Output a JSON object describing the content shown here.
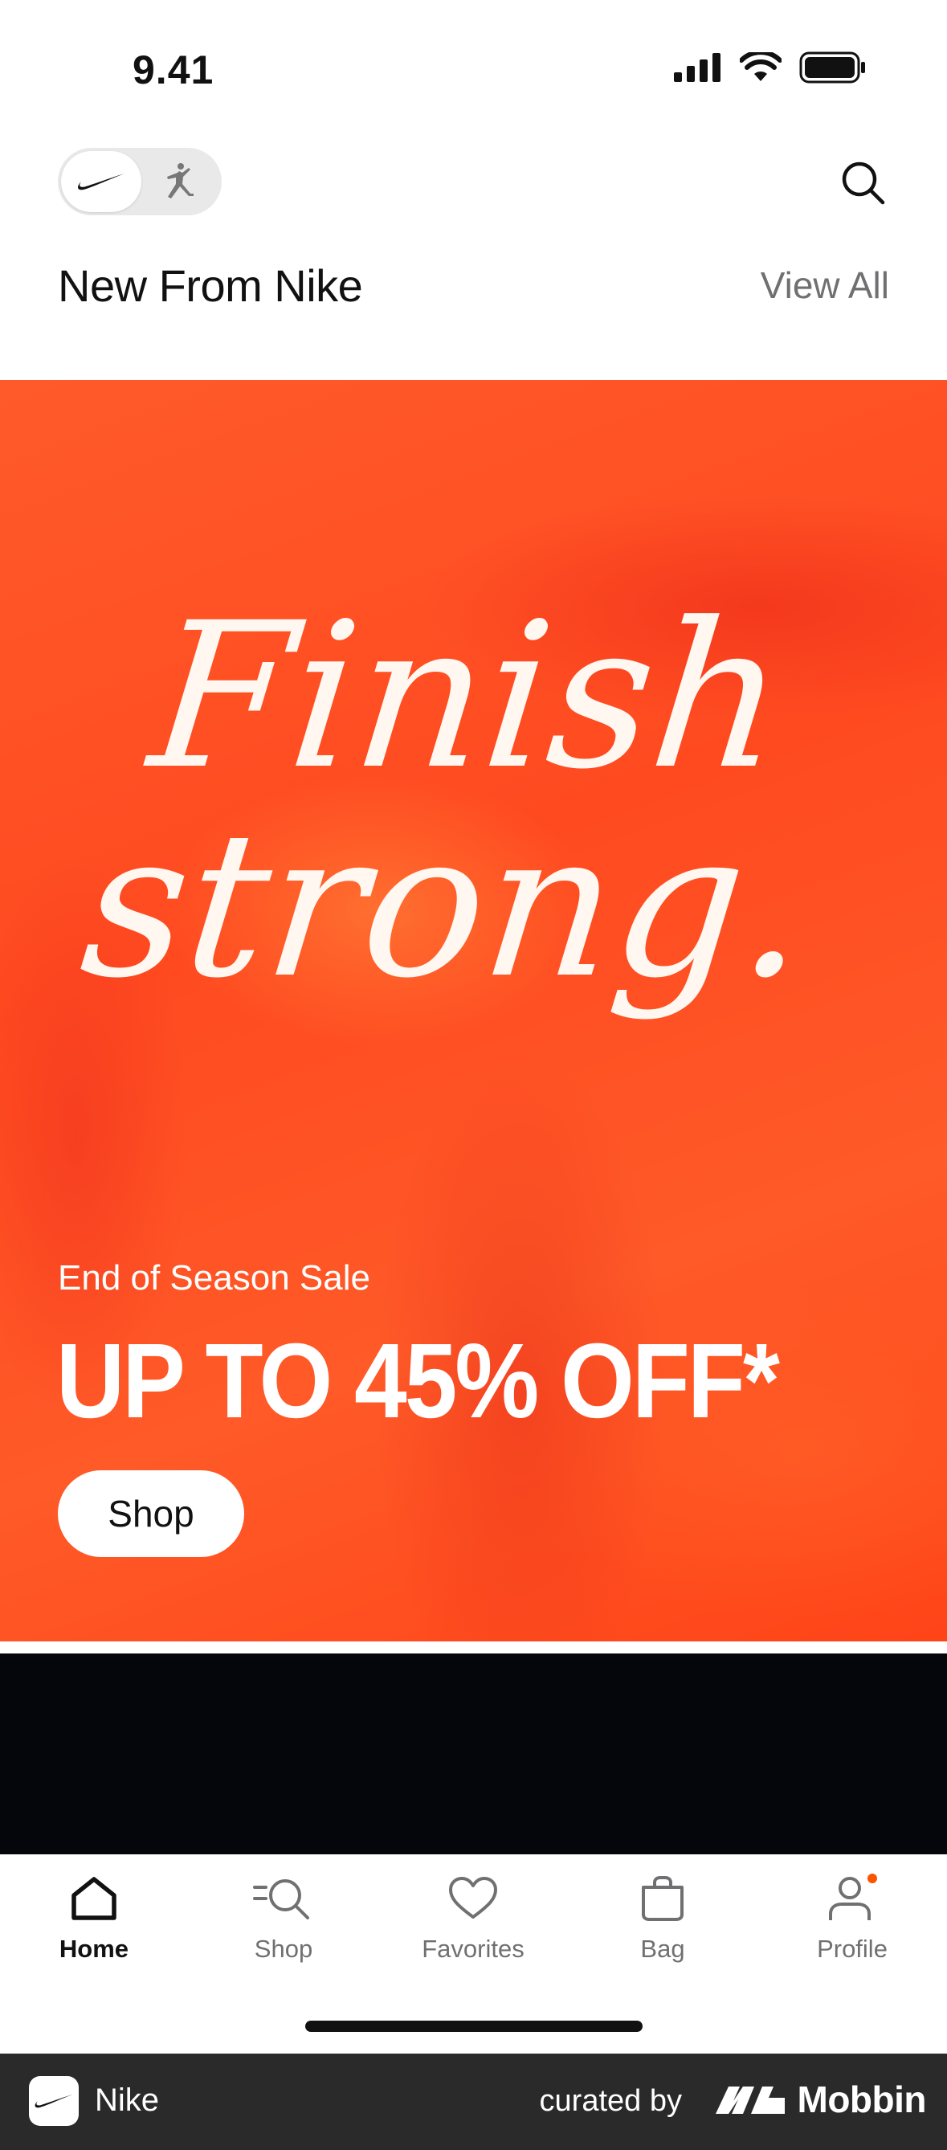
{
  "status_bar": {
    "time": "9.41"
  },
  "header": {
    "brand_toggle": {
      "selected": "nike-icon",
      "other": "jordan-icon"
    },
    "search_icon": "search-icon"
  },
  "section": {
    "title": "New From Nike",
    "view_all": "View All"
  },
  "hero": {
    "script_line1": "Finish",
    "script_line2": "strong.",
    "eyebrow": "End of Season Sale",
    "headline": "UP TO 45% OFF*",
    "button_label": "Shop",
    "background_color": "#ff4e22"
  },
  "tab_bar": {
    "items": [
      {
        "label": "Home",
        "icon": "home-icon",
        "active": true
      },
      {
        "label": "Shop",
        "icon": "shop-search-icon",
        "active": false
      },
      {
        "label": "Favorites",
        "icon": "heart-icon",
        "active": false
      },
      {
        "label": "Bag",
        "icon": "bag-icon",
        "active": false
      },
      {
        "label": "Profile",
        "icon": "profile-icon",
        "active": false,
        "badge": true
      }
    ],
    "badge_color": "#fa5400"
  },
  "footer": {
    "app_name": "Nike",
    "curated_by": "curated by",
    "brand": "Mobbin"
  }
}
